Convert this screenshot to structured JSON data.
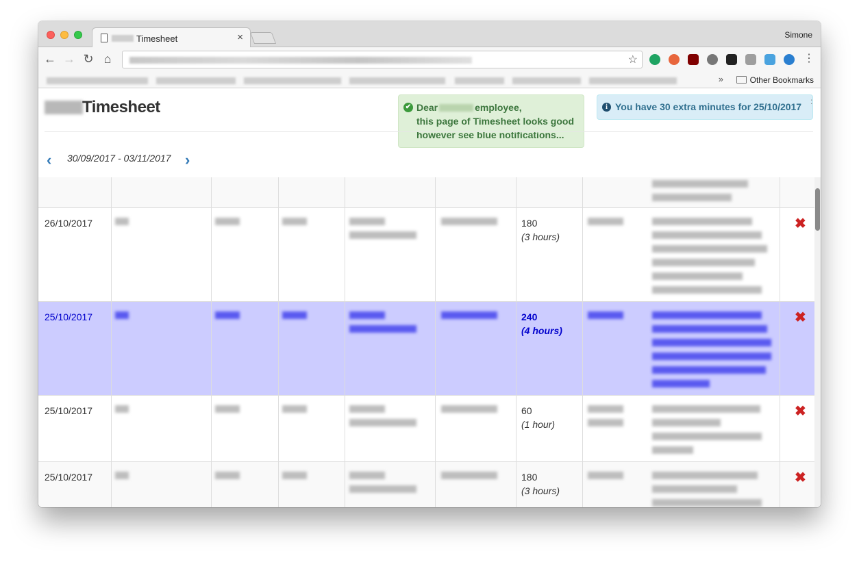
{
  "browser": {
    "tab_title": "Timesheet",
    "tab_close": "×",
    "profile_name": "Simone",
    "back": "←",
    "forward": "→",
    "reload": "↻",
    "home": "⌂",
    "star": "☆",
    "menu": "⋮",
    "bookmarks_overflow": "»",
    "other_bookmarks": "Other Bookmarks"
  },
  "page": {
    "title": "Timesheet",
    "success_alert": {
      "check": "✔",
      "line1_a": "Dear",
      "line1_b": "employee,",
      "line2": "this page of Timesheet looks good",
      "line3": "however see blue notifications..."
    },
    "info_alert": {
      "icon": "i",
      "text": "You have 30 extra minutes for 25/10/2017"
    },
    "date_range": "30/09/2017 - 03/11/2017",
    "prev_arrow": "‹",
    "next_arrow": "›"
  },
  "table": {
    "delete_icon": "✖",
    "rows": [
      {
        "date": "26/10/2017",
        "minutes": "180",
        "hours": "(3 hours)"
      },
      {
        "date": "25/10/2017",
        "minutes": "240",
        "hours": "(4 hours)"
      },
      {
        "date": "25/10/2017",
        "minutes": "60",
        "hours": "(1 hour)"
      },
      {
        "date": "25/10/2017",
        "minutes": "180",
        "hours": "(3 hours)"
      }
    ]
  },
  "colors": {
    "highlight_row": "#ccccff",
    "highlight_text": "#0000cc",
    "success_bg": "#dff0d8",
    "info_bg": "#d9edf7",
    "delete": "#cc2222",
    "link": "#337ab7"
  }
}
